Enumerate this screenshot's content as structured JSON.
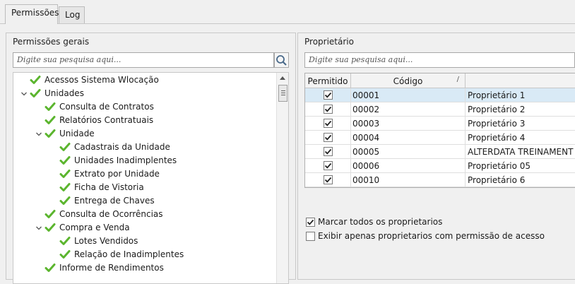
{
  "tabs": [
    {
      "label": "Permissões",
      "active": true
    },
    {
      "label": "Log",
      "active": false
    }
  ],
  "left_panel": {
    "title": "Permissões gerais",
    "search_placeholder": "Digite sua pesquisa aqui...",
    "tree": [
      {
        "label": "Acessos Sistema Wlocação",
        "level": 0,
        "expandable": false,
        "checked": true
      },
      {
        "label": "Unidades",
        "level": 0,
        "expandable": true,
        "checked": true
      },
      {
        "label": "Consulta de Contratos",
        "level": 1,
        "expandable": false,
        "checked": true
      },
      {
        "label": "Relatórios Contratuais",
        "level": 1,
        "expandable": false,
        "checked": true
      },
      {
        "label": "Unidade",
        "level": 1,
        "expandable": true,
        "checked": true
      },
      {
        "label": "Cadastrais da Unidade",
        "level": 2,
        "expandable": false,
        "checked": true
      },
      {
        "label": "Unidades Inadimplentes",
        "level": 2,
        "expandable": false,
        "checked": true
      },
      {
        "label": "Extrato por Unidade",
        "level": 2,
        "expandable": false,
        "checked": true
      },
      {
        "label": "Ficha de Vistoria",
        "level": 2,
        "expandable": false,
        "checked": true
      },
      {
        "label": "Entrega de Chaves",
        "level": 2,
        "expandable": false,
        "checked": true
      },
      {
        "label": "Consulta de Ocorrências",
        "level": 1,
        "expandable": false,
        "checked": true
      },
      {
        "label": "Compra e Venda",
        "level": 1,
        "expandable": true,
        "checked": true
      },
      {
        "label": "Lotes Vendidos",
        "level": 2,
        "expandable": false,
        "checked": true
      },
      {
        "label": "Relação de Inadimplentes",
        "level": 2,
        "expandable": false,
        "checked": true
      },
      {
        "label": "Informe de Rendimentos",
        "level": 1,
        "expandable": false,
        "checked": true
      }
    ]
  },
  "right_panel": {
    "title": "Proprietário",
    "search_placeholder": "Digite sua pesquisa aqui...",
    "columns": [
      "Permitido",
      "Código",
      "/",
      ""
    ],
    "rows": [
      {
        "permitido": true,
        "codigo": "00001",
        "nome": "Proprietário 1",
        "selected": true
      },
      {
        "permitido": true,
        "codigo": "00002",
        "nome": "Proprietário 2",
        "selected": false
      },
      {
        "permitido": true,
        "codigo": "00003",
        "nome": "Proprietário 3",
        "selected": false
      },
      {
        "permitido": true,
        "codigo": "00004",
        "nome": "Proprietário 4",
        "selected": false
      },
      {
        "permitido": true,
        "codigo": "00005",
        "nome": "ALTERDATA TREINAMENT",
        "selected": false
      },
      {
        "permitido": true,
        "codigo": "00006",
        "nome": "Proprietário 05",
        "selected": false
      },
      {
        "permitido": true,
        "codigo": "00010",
        "nome": "Proprietário 6",
        "selected": false
      }
    ],
    "options": [
      {
        "label": "Marcar todos os proprietarios",
        "checked": true
      },
      {
        "label": "Exibir apenas proprietarios com permissão de acesso",
        "checked": false
      }
    ]
  },
  "colors": {
    "check_green": "#5bb52e",
    "selected_row": "#d9eaf6",
    "border": "#c8c8c8"
  },
  "icons": {
    "search": "magnifier-icon",
    "tree_check": "green-check-icon",
    "expander": "chevron-down-icon"
  }
}
